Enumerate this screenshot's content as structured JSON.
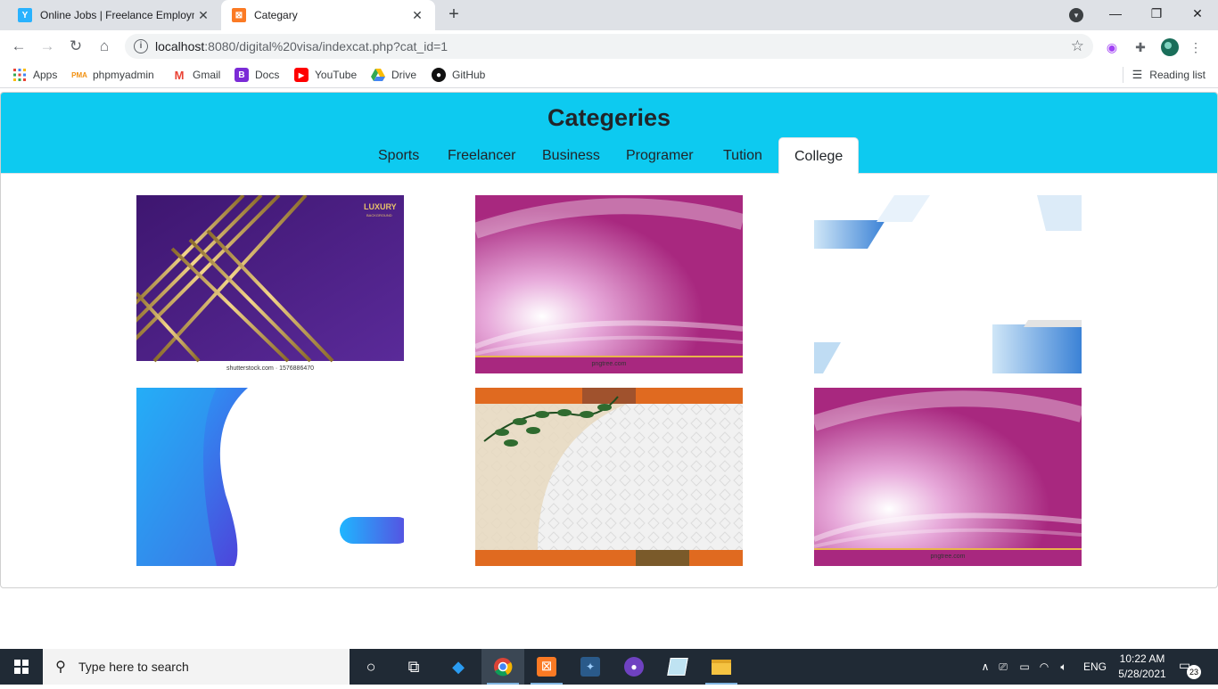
{
  "browser": {
    "tabs": [
      {
        "title": "Online Jobs | Freelance Employm",
        "icon": "freelancer-favicon",
        "active": false
      },
      {
        "title": "Categary",
        "icon": "xampp-favicon",
        "active": true
      }
    ],
    "new_tab": "+",
    "url_host": "localhost",
    "url_rest": ":8080/digital%20visa/indexcat.php?cat_id=1",
    "bookmarks": [
      {
        "label": "Apps",
        "icon": "apps-grid-icon"
      },
      {
        "label": "phpmyadmin",
        "icon": "phpmyadmin-icon"
      },
      {
        "label": "Gmail",
        "icon": "gmail-icon"
      },
      {
        "label": "Docs",
        "icon": "docs-icon"
      },
      {
        "label": "YouTube",
        "icon": "youtube-icon"
      },
      {
        "label": "Drive",
        "icon": "drive-icon"
      },
      {
        "label": "GitHub",
        "icon": "github-icon"
      }
    ],
    "reading_list": "Reading list"
  },
  "page": {
    "title": "Categeries",
    "tabs": [
      "Sports",
      "Freelancer",
      "Business",
      "Programer",
      "Tution",
      "College"
    ],
    "active_tab": "College",
    "images": [
      {
        "name": "luxury-purple-background",
        "caption": "LUXURY",
        "sub": "BACKGROUND",
        "watermark": "shutterstock.com · 1576886470"
      },
      {
        "name": "magenta-glow-background",
        "watermark": "pngtree.com"
      },
      {
        "name": "blue-white-geometric-background"
      },
      {
        "name": "blue-wave-background"
      },
      {
        "name": "floral-vine-pattern-background"
      },
      {
        "name": "magenta-glow-background-2",
        "watermark": "pngtree.com"
      }
    ]
  },
  "taskbar": {
    "search_placeholder": "Type here to search",
    "language": "ENG",
    "time": "10:22 AM",
    "date": "5/28/2021",
    "notifications": "23"
  },
  "colors": {
    "header_bg": "#0dcaf0",
    "taskbar_bg": "#202a35"
  }
}
